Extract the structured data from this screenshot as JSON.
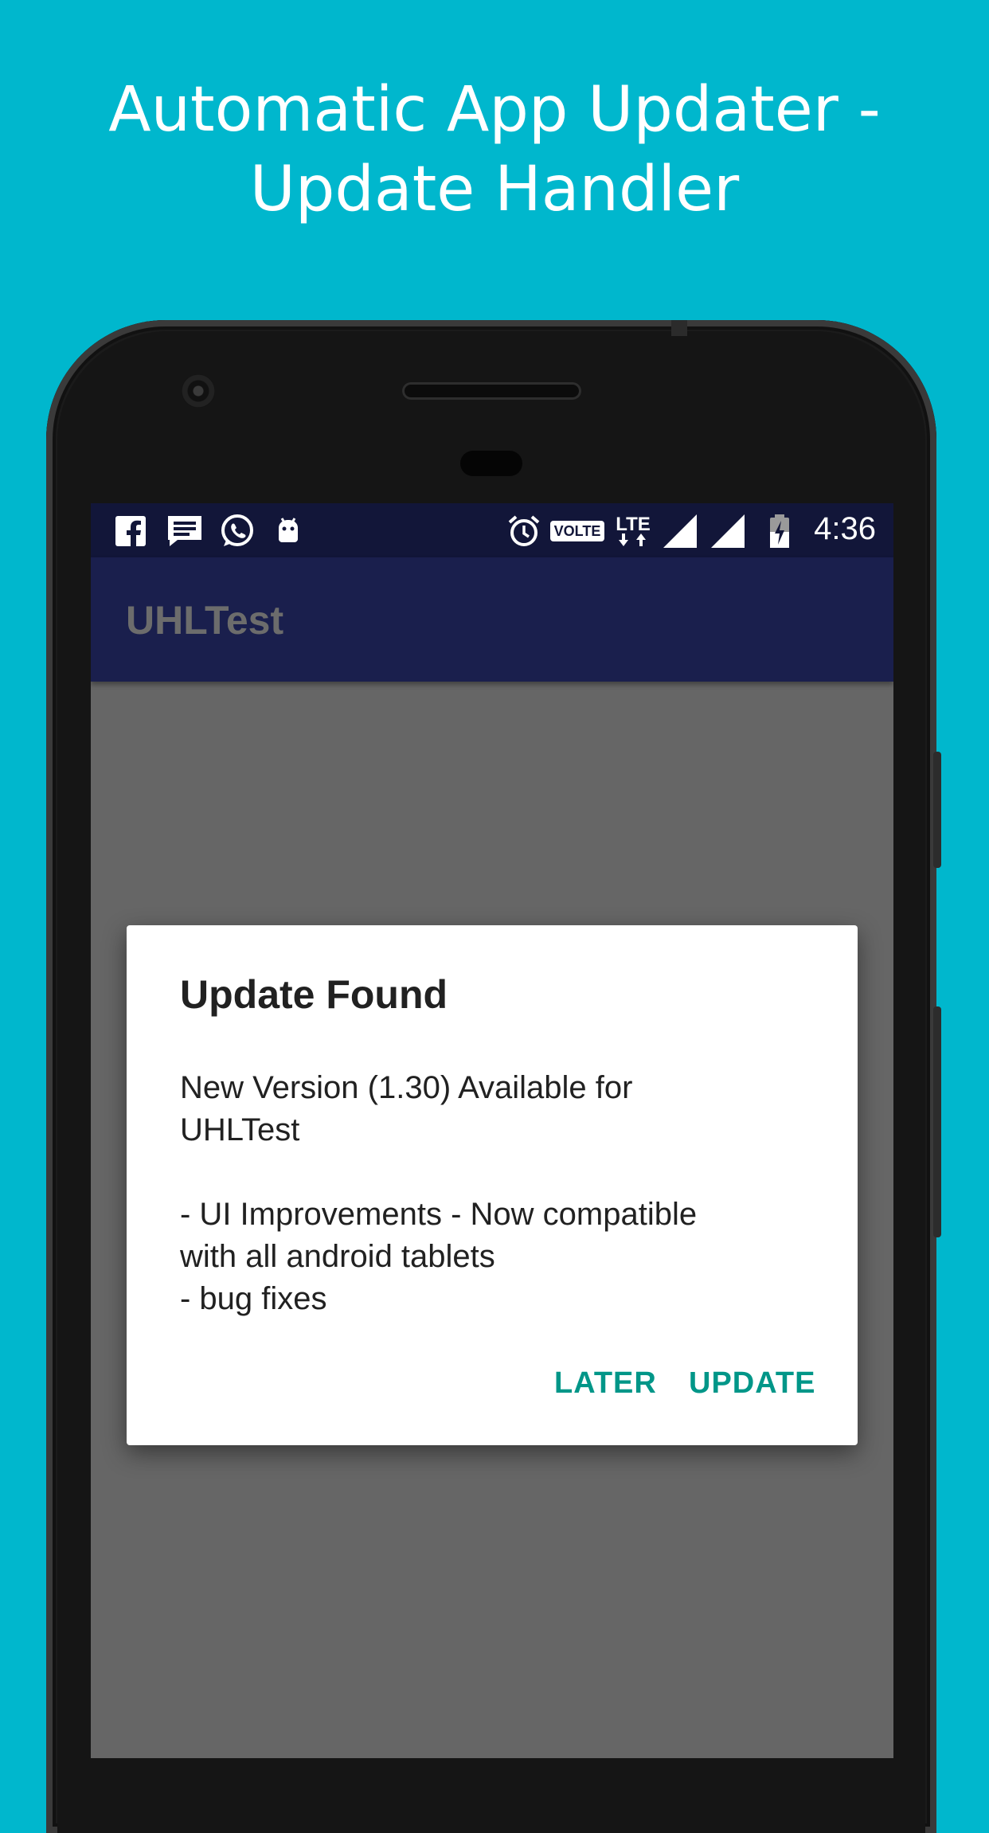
{
  "promo": {
    "title_line1": "Automatic App Updater -",
    "title_line2": "Update Handler"
  },
  "status_bar": {
    "left_icons": [
      "facebook-icon",
      "message-icon",
      "whatsapp-icon",
      "android-debug-icon"
    ],
    "right_icons": [
      "alarm-icon",
      "volte-badge",
      "lte-data-icon",
      "signal-icon",
      "signal-icon",
      "battery-charging-icon"
    ],
    "volte_label": "VOLTE",
    "lte_label": "LTE",
    "time": "4:36"
  },
  "app_bar": {
    "title": "UHLTest"
  },
  "dialog": {
    "title": "Update Found",
    "message_lines": [
      "New Version (1.30) Available for",
      "UHLTest",
      "",
      "- UI Improvements - Now compatible",
      "with all android tablets",
      "- bug fixes"
    ],
    "later_label": "LATER",
    "update_label": "UPDATE"
  },
  "colors": {
    "background": "#00B7CD",
    "status_bar": "#121639",
    "app_bar": "#1A1F4D",
    "scrim": "#666666",
    "accent": "#009688"
  }
}
